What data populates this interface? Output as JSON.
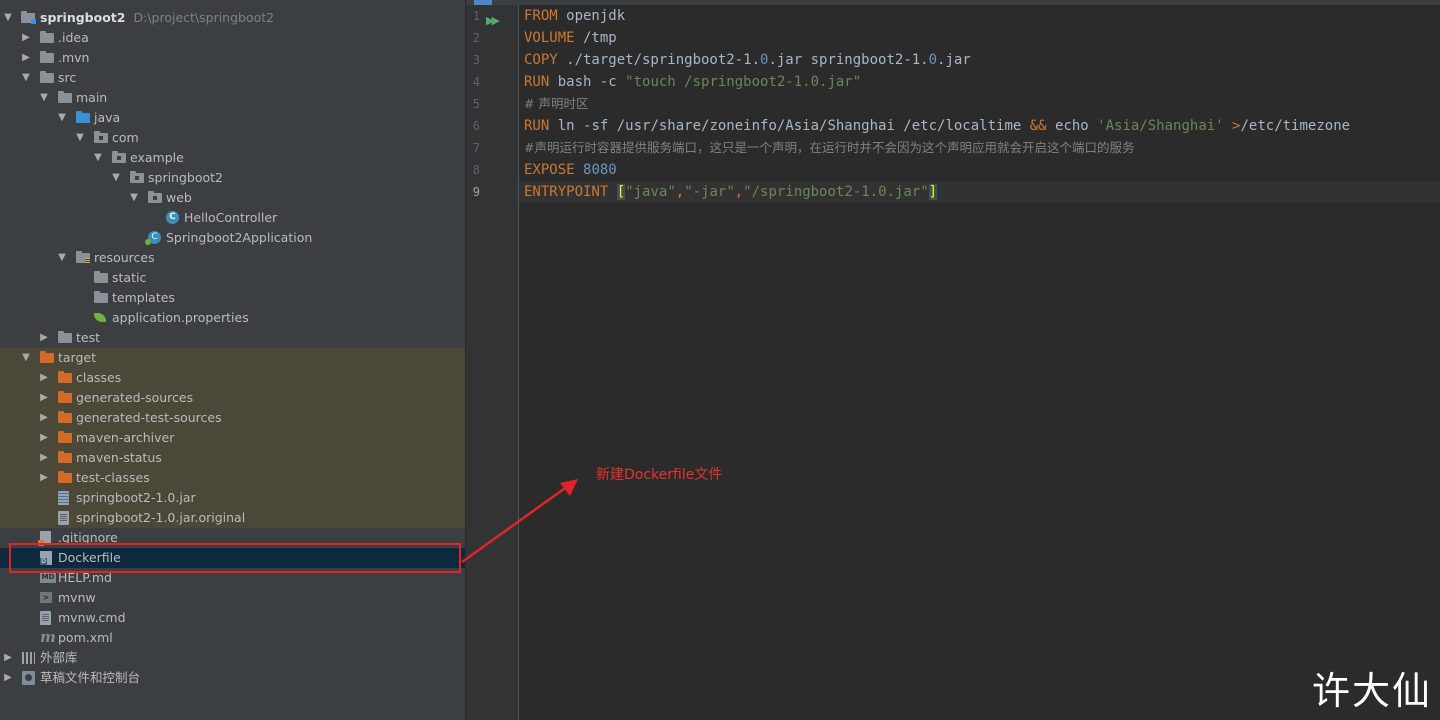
{
  "project": {
    "name": "springboot2",
    "path": "D:\\project\\springboot2",
    "items": [
      {
        "label": ".idea",
        "depth": 1,
        "arrow": "right",
        "icon": "folder-grey",
        "bg": ""
      },
      {
        "label": ".mvn",
        "depth": 1,
        "arrow": "right",
        "icon": "folder-grey",
        "bg": ""
      },
      {
        "label": "src",
        "depth": 1,
        "arrow": "down",
        "icon": "folder-grey",
        "bg": ""
      },
      {
        "label": "main",
        "depth": 2,
        "arrow": "down",
        "icon": "folder-grey",
        "bg": ""
      },
      {
        "label": "java",
        "depth": 3,
        "arrow": "down",
        "icon": "folder-blue",
        "bg": ""
      },
      {
        "label": "com",
        "depth": 4,
        "arrow": "down",
        "icon": "folder-package",
        "bg": ""
      },
      {
        "label": "example",
        "depth": 5,
        "arrow": "down",
        "icon": "folder-package",
        "bg": ""
      },
      {
        "label": "springboot2",
        "depth": 6,
        "arrow": "down",
        "icon": "folder-package",
        "bg": ""
      },
      {
        "label": "web",
        "depth": 7,
        "arrow": "down",
        "icon": "folder-package",
        "bg": ""
      },
      {
        "label": "HelloController",
        "depth": 8,
        "arrow": "none",
        "icon": "class",
        "bg": ""
      },
      {
        "label": "Springboot2Application",
        "depth": 7,
        "arrow": "none",
        "icon": "spring-app",
        "bg": ""
      },
      {
        "label": "resources",
        "depth": 3,
        "arrow": "down",
        "icon": "folder-resources",
        "bg": ""
      },
      {
        "label": "static",
        "depth": 4,
        "arrow": "none",
        "icon": "folder-grey",
        "bg": ""
      },
      {
        "label": "templates",
        "depth": 4,
        "arrow": "none",
        "icon": "folder-grey",
        "bg": ""
      },
      {
        "label": "application.properties",
        "depth": 4,
        "arrow": "none",
        "icon": "spring-leaf",
        "bg": ""
      },
      {
        "label": "test",
        "depth": 2,
        "arrow": "right",
        "icon": "folder-grey",
        "bg": ""
      },
      {
        "label": "target",
        "depth": 1,
        "arrow": "down",
        "icon": "folder-orange",
        "bg": "excluded"
      },
      {
        "label": "classes",
        "depth": 2,
        "arrow": "right",
        "icon": "folder-orange",
        "bg": "excluded"
      },
      {
        "label": "generated-sources",
        "depth": 2,
        "arrow": "right",
        "icon": "folder-orange",
        "bg": "excluded"
      },
      {
        "label": "generated-test-sources",
        "depth": 2,
        "arrow": "right",
        "icon": "folder-orange",
        "bg": "excluded"
      },
      {
        "label": "maven-archiver",
        "depth": 2,
        "arrow": "right",
        "icon": "folder-orange",
        "bg": "excluded"
      },
      {
        "label": "maven-status",
        "depth": 2,
        "arrow": "right",
        "icon": "folder-orange",
        "bg": "excluded"
      },
      {
        "label": "test-classes",
        "depth": 2,
        "arrow": "right",
        "icon": "folder-orange",
        "bg": "excluded"
      },
      {
        "label": "springboot2-1.0.jar",
        "depth": 2,
        "arrow": "none",
        "icon": "jar",
        "bg": "excluded"
      },
      {
        "label": "springboot2-1.0.jar.original",
        "depth": 2,
        "arrow": "none",
        "icon": "file-doc",
        "bg": "excluded"
      },
      {
        "label": ".gitignore",
        "depth": 1,
        "arrow": "none",
        "icon": "gitignore",
        "bg": ""
      },
      {
        "label": "Dockerfile",
        "depth": 1,
        "arrow": "none",
        "icon": "docker",
        "bg": "selected"
      },
      {
        "label": "HELP.md",
        "depth": 1,
        "arrow": "none",
        "icon": "markdown",
        "bg": ""
      },
      {
        "label": "mvnw",
        "depth": 1,
        "arrow": "none",
        "icon": "terminal",
        "bg": ""
      },
      {
        "label": "mvnw.cmd",
        "depth": 1,
        "arrow": "none",
        "icon": "file-doc",
        "bg": ""
      },
      {
        "label": "pom.xml",
        "depth": 1,
        "arrow": "none",
        "icon": "maven",
        "bg": ""
      },
      {
        "label": "外部库",
        "depth": 0,
        "arrow": "right",
        "icon": "library",
        "bg": ""
      },
      {
        "label": "草稿文件和控制台",
        "depth": 0,
        "arrow": "right",
        "icon": "scratch",
        "bg": ""
      }
    ]
  },
  "editor": {
    "current_line": 9,
    "lines": [
      [
        {
          "t": "FROM",
          "c": "kw"
        },
        {
          "t": " openjdk",
          "c": ""
        }
      ],
      [
        {
          "t": "VOLUME",
          "c": "kw"
        },
        {
          "t": " /tmp",
          "c": ""
        }
      ],
      [
        {
          "t": "COPY",
          "c": "kw"
        },
        {
          "t": " ./target/springboot2-1.",
          "c": ""
        },
        {
          "t": "0",
          "c": "num"
        },
        {
          "t": ".jar springboot2-1.",
          "c": ""
        },
        {
          "t": "0",
          "c": "num"
        },
        {
          "t": ".jar",
          "c": ""
        }
      ],
      [
        {
          "t": "RUN",
          "c": "kw"
        },
        {
          "t": " bash -c ",
          "c": ""
        },
        {
          "t": "\"touch /springboot2-1.0.jar\"",
          "c": "str"
        }
      ],
      [
        {
          "t": "# 声明时区",
          "c": "cm"
        }
      ],
      [
        {
          "t": "RUN",
          "c": "kw"
        },
        {
          "t": " ln -sf /usr/share/zoneinfo/Asia/Shanghai /etc/localtime ",
          "c": ""
        },
        {
          "t": "&&",
          "c": "kw"
        },
        {
          "t": " echo ",
          "c": ""
        },
        {
          "t": "'Asia/Shanghai'",
          "c": "str"
        },
        {
          "t": " ",
          "c": ""
        },
        {
          "t": ">",
          "c": "kw"
        },
        {
          "t": "/etc/timezone",
          "c": ""
        }
      ],
      [
        {
          "t": "#声明运行时容器提供服务端口，这只是一个声明，在运行时并不会因为这个声明应用就会开启这个端口的服务",
          "c": "cm"
        }
      ],
      [
        {
          "t": "EXPOSE",
          "c": "kw"
        },
        {
          "t": " ",
          "c": ""
        },
        {
          "t": "8080",
          "c": "num"
        }
      ],
      [
        {
          "t": "ENTRYPOINT",
          "c": "kw"
        },
        {
          "t": " ",
          "c": ""
        },
        {
          "t": "[",
          "c": "br"
        },
        {
          "t": "\"java\"",
          "c": "str"
        },
        {
          "t": ",",
          "c": "kw"
        },
        {
          "t": "\"-jar\"",
          "c": "str"
        },
        {
          "t": ",",
          "c": "kw"
        },
        {
          "t": "\"/springboot2-1.0.jar\"",
          "c": "str"
        },
        {
          "t": "]",
          "c": "br"
        }
      ]
    ]
  },
  "annotation": {
    "callout": "新建Dockerfile文件",
    "color": "#e0242a"
  },
  "watermark": "许大仙",
  "colors": {
    "tree_bg": "#3c3f41",
    "excluded_bg": "#4b4837",
    "selected_bg": "#0d293e",
    "editor_bg": "#2b2b2b",
    "keyword": "#cc7832",
    "number": "#6897bb",
    "string": "#6a8759",
    "comment": "#808080"
  }
}
